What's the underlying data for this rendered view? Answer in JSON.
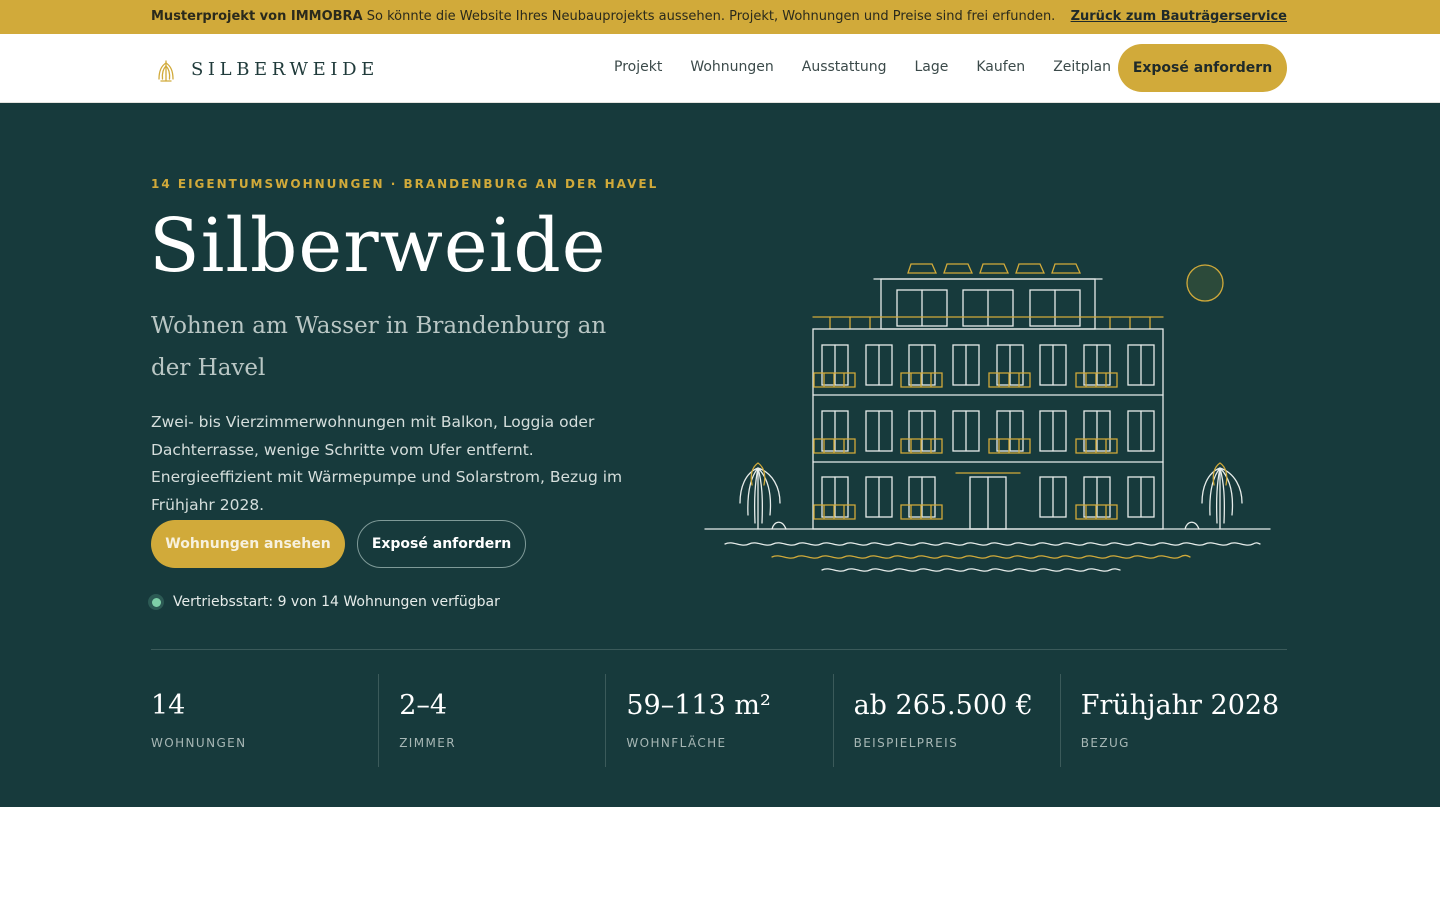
{
  "promo": {
    "brand": "Musterprojekt von IMMOBRA",
    "text": "So könnte die Website Ihres Neubauprojekts aussehen. Projekt, Wohnungen und Preise sind frei erfunden.",
    "link": "Zurück zum Bauträgerservice"
  },
  "header": {
    "logo_text": "SILBERWEIDE",
    "nav": [
      "Projekt",
      "Wohnungen",
      "Ausstattung",
      "Lage",
      "Kaufen",
      "Zeitplan"
    ],
    "cta": "Exposé anfordern"
  },
  "hero": {
    "eyebrow": "14 EIGENTUMSWOHNUNGEN · BRANDENBURG AN DER HAVEL",
    "title": "Silberweide",
    "subtitle": "Wohnen am Wasser in Brandenburg an der Havel",
    "description": "Zwei- bis Vierzimmerwohnungen mit Balkon, Loggia oder Dachterrasse, wenige Schritte vom Ufer entfernt. Energieeffizient mit Wärmepumpe und Solarstrom, Bezug im Frühjahr 2028.",
    "primary_button": "Wohnungen ansehen",
    "secondary_button": "Exposé anfordern",
    "availability": "Vertriebsstart: 9 von 14 Wohnungen verfügbar"
  },
  "stats": [
    {
      "value": "14",
      "label": "WOHNUNGEN"
    },
    {
      "value": "2–4",
      "label": "ZIMMER"
    },
    {
      "value": "59–113 m²",
      "label": "WOHNFLÄCHE"
    },
    {
      "value": "ab 265.500 €",
      "label": "BEISPIELPREIS"
    },
    {
      "value": "Frühjahr 2028",
      "label": "BEZUG"
    }
  ],
  "colors": {
    "accent_gold": "#d1aa3a",
    "hero_background": "#173a3c",
    "status_green": "#7ed0a8",
    "white": "#ffffff"
  },
  "icons": {
    "logo": "willow-tree-icon",
    "status": "status-dot-icon",
    "illustration": "apartment-building-illustration"
  }
}
